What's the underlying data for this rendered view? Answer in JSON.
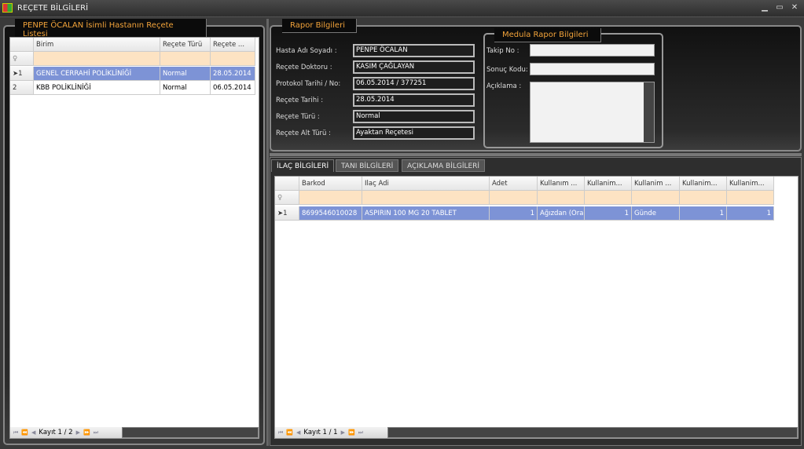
{
  "window": {
    "title": "REÇETE BİLGİLERİ",
    "controls": [
      "▁",
      "▭",
      "✕"
    ]
  },
  "left": {
    "title": "PENPE ÖCALAN İsimli Hastanın Reçete Listesi",
    "columns": [
      "Birim",
      "Reçete Türü",
      "Reçete ..."
    ],
    "rows": [
      {
        "ind": "➤1",
        "cells": [
          "GENEL CERRAHİ POLİKLİNİĞİ",
          "Normal",
          "28.05.2014"
        ],
        "selected": true
      },
      {
        "ind": "2",
        "cells": [
          "KBB POLİKLİNİĞİ",
          "Normal",
          "06.05.2014"
        ],
        "selected": false
      }
    ],
    "nav": {
      "record": "Kayıt 1 / 2"
    }
  },
  "rapor": {
    "title": "Rapor Bilgileri",
    "fields": [
      {
        "label": "Hasta Adı Soyadı :",
        "value": "PENPE ÖCALAN"
      },
      {
        "label": "Reçete Doktoru :",
        "value": "KASIM ÇAĞLAYAN"
      },
      {
        "label": "Protokol Tarihi / No:",
        "value": "06.05.2014 / 377251"
      },
      {
        "label": "Reçete Tarihi :",
        "value": "28.05.2014"
      },
      {
        "label": "Reçete Türü :",
        "value": "Normal"
      },
      {
        "label": "Reçete Alt Türü :",
        "value": "Ayaktan Reçetesi"
      }
    ]
  },
  "medula": {
    "title": "Medula Rapor Bilgileri",
    "takip_label": "Takip No :",
    "takip_value": "",
    "sonuc_label": "Sonuç Kodu:",
    "sonuc_value": "",
    "aciklama_label": "Açıklama :",
    "aciklama_value": ""
  },
  "tabs": [
    {
      "label": "İLAÇ BİLGİLERİ",
      "active": true
    },
    {
      "label": "TANI BİLGİLERİ"
    },
    {
      "label": "AÇIKLAMA BİLGİLERİ"
    }
  ],
  "ilac": {
    "columns": [
      "Barkod",
      "Ilaç Adi",
      "Adet",
      "Kullanım ...",
      "Kullanim...",
      "Kullanim ...",
      "Kullanim...",
      "Kullanim..."
    ],
    "rows": [
      {
        "ind": "➤1",
        "cells": [
          "8699546010028",
          "ASPIRIN 100 MG 20 TABLET",
          "1",
          "Ağızdan (Oral)",
          "1",
          "Günde",
          "1",
          "1"
        ],
        "selected": true
      }
    ],
    "nav": {
      "record": "Kayıt 1 / 1"
    }
  },
  "nav_icons": [
    "first-icon",
    "prev-page-icon",
    "prev-icon",
    "next-icon",
    "next-page-icon",
    "last-icon"
  ]
}
